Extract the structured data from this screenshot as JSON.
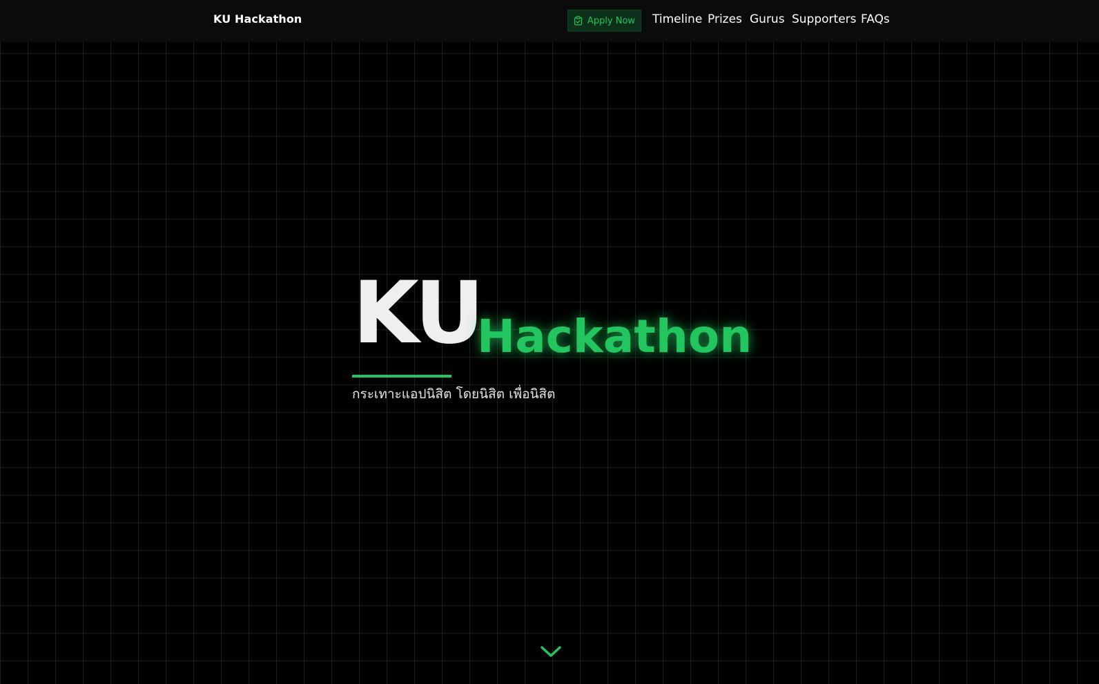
{
  "navbar": {
    "brand": "KU Hackathon",
    "apply_label": "Apply Now",
    "links": [
      "Timeline",
      "Prizes",
      "Gurus",
      "Supporters",
      "FAQs"
    ]
  },
  "hero": {
    "title_main": "KU",
    "title_accent": "Hackathon",
    "tagline": "กระเทาะแอปนิสิต โดยนิสิต เพื่อนิสิต"
  },
  "icons": {
    "apply": "clipboard-check-icon",
    "scroll": "chevron-down-icon"
  },
  "colors": {
    "accent": "#22c55e",
    "background": "#000000",
    "navbar": "#0b0b0b",
    "grid_line": "#1c1c1c",
    "button_bg": "#0c3019"
  }
}
